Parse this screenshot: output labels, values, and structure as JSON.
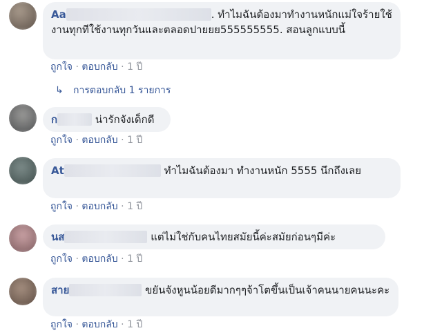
{
  "comments": [
    {
      "author": "Aa",
      "text": "ทำไมฉันต้องมาทำงานหนักแม่ใจร้ายใช้งานทุกทีใช้งานทุกวันและตลอดปายยย555555555. สอนลูกแบบนี้",
      "actions": {
        "like": "ถูกใจ",
        "reply": "ตอบกลับ",
        "time": "1 ปี"
      }
    },
    {
      "author": "ก",
      "text": "น่ารักจังเด็กดี",
      "actions": {
        "like": "ถูกใจ",
        "reply": "ตอบกลับ",
        "time": "1 ปี"
      }
    },
    {
      "author": "At",
      "text": "ทำไมฉันต้องมา ทำงานหนัก 5555 นึกถึงเลย",
      "actions": {
        "like": "ถูกใจ",
        "reply": "ตอบกลับ",
        "time": "1 ปี"
      }
    },
    {
      "author": "นส",
      "text": "แต่ไม่ใช่กับคนไทยสมัยนี้ค่ะสมัยก่อนๆมีค่ะ",
      "actions": {
        "like": "ถูกใจ",
        "reply": "ตอบกลับ",
        "time": "1 ปี"
      }
    },
    {
      "author": "สาย",
      "text": "ขยันจังหูนน้อยดีมากๆๆจ้าโตขึ้นเป็นเจ้าคนนายคนนะคะ",
      "actions": {
        "like": "ถูกใจ",
        "reply": "ตอบกลับ",
        "time": "1 ปี"
      }
    }
  ],
  "replies_link": {
    "arrow": "↳",
    "label": "การตอบกลับ 1 รายการ"
  },
  "separator": "·",
  "colors": {
    "link": "#385898",
    "bubble": "#f0f2f5",
    "meta": "#90949c"
  }
}
